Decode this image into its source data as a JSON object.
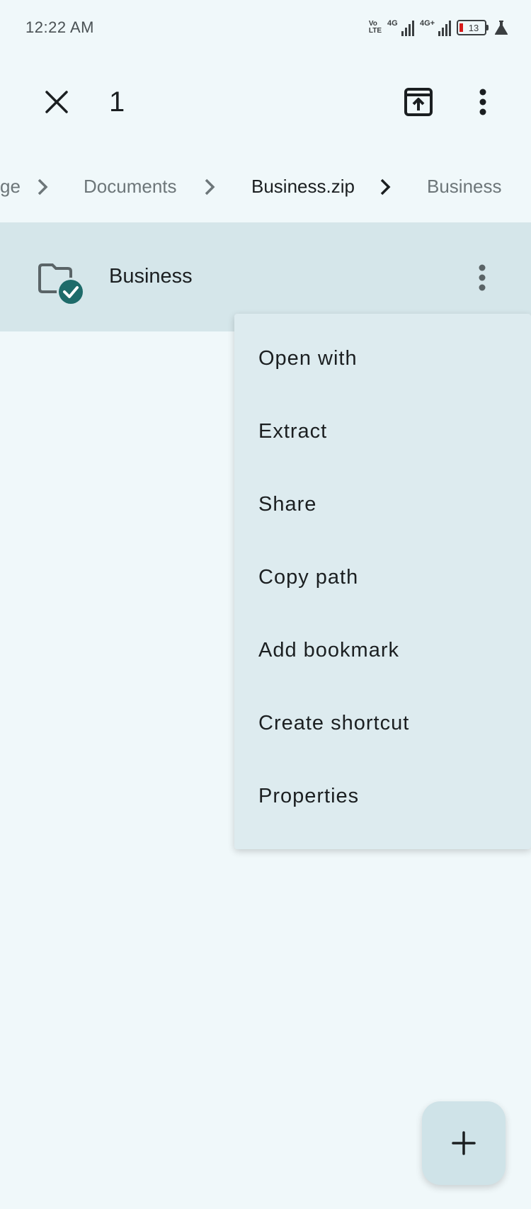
{
  "status_bar": {
    "time": "12:22 AM",
    "volte_top": "Vo",
    "volte_bottom": "LTE",
    "signal1_tag": "4G",
    "signal2_tag": "4G+",
    "battery_level": "13",
    "battery_color": "#d71b1b"
  },
  "action_bar": {
    "selection_count": "1",
    "close_icon": "close-icon",
    "archive_icon": "archive-upload-icon",
    "more_icon": "more-vertical-icon"
  },
  "breadcrumbs": [
    {
      "label": "ge"
    },
    {
      "label": "Documents"
    },
    {
      "label": "Business.zip"
    },
    {
      "label": "Business"
    }
  ],
  "file_list": {
    "items": [
      {
        "name": "Business",
        "icon": "folder-icon",
        "selected": true
      }
    ]
  },
  "context_menu": {
    "items": [
      {
        "label": "Open with"
      },
      {
        "label": "Extract"
      },
      {
        "label": "Share"
      },
      {
        "label": "Copy path"
      },
      {
        "label": "Add bookmark"
      },
      {
        "label": "Create shortcut"
      },
      {
        "label": "Properties"
      }
    ]
  },
  "fab": {
    "icon": "plus-icon"
  },
  "colors": {
    "background": "#f0f8fa",
    "selected_row": "#d5e6ea",
    "menu_background": "#ddebef",
    "accent": "#1e6b6a"
  }
}
